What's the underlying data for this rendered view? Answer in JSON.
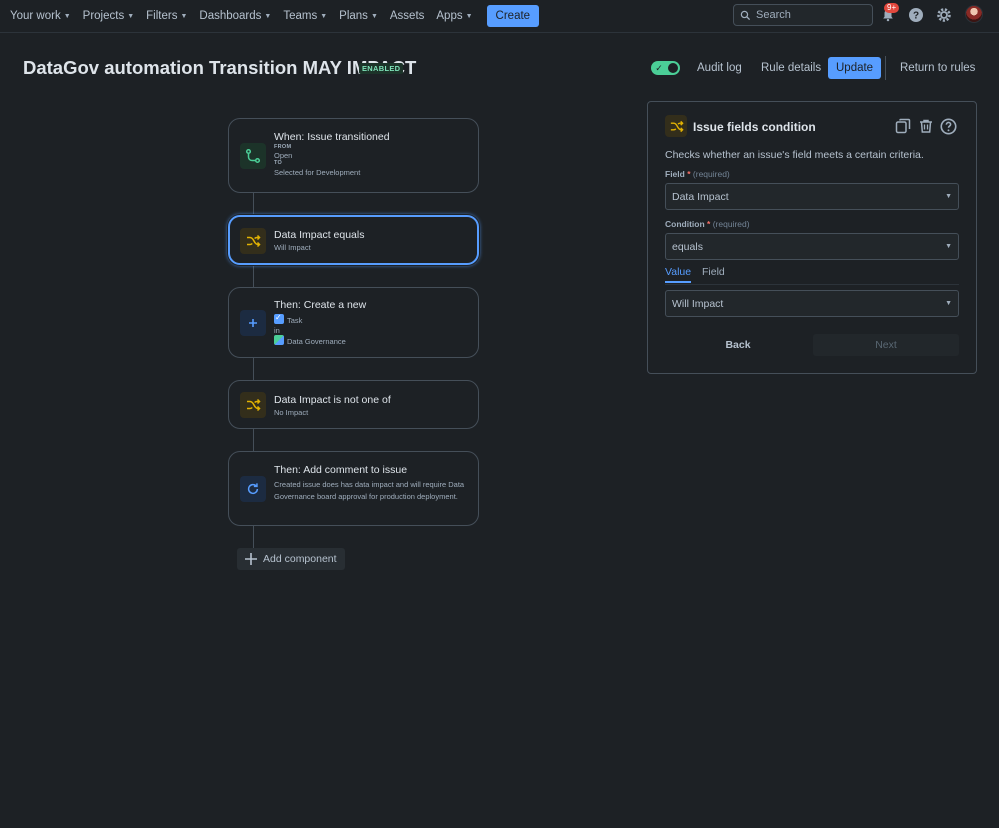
{
  "nav": {
    "items": [
      {
        "label": "Your work",
        "dropdown": true
      },
      {
        "label": "Projects",
        "dropdown": true
      },
      {
        "label": "Filters",
        "dropdown": true
      },
      {
        "label": "Dashboards",
        "dropdown": true
      },
      {
        "label": "Teams",
        "dropdown": true
      },
      {
        "label": "Plans",
        "dropdown": true
      },
      {
        "label": "Assets",
        "dropdown": false
      },
      {
        "label": "Apps",
        "dropdown": true
      }
    ],
    "create_label": "Create",
    "search_placeholder": "Search",
    "notifications_badge": "9+",
    "icons": [
      "bell-icon",
      "help-icon",
      "gear-icon",
      "avatar"
    ]
  },
  "header": {
    "title": "DataGov automation Transition MAY IMPACT",
    "status": "ENABLED",
    "toggle_on": true,
    "audit_log_label": "Audit log",
    "rule_details_label": "Rule details",
    "update_label": "Update",
    "return_label": "Return to rules"
  },
  "flow": {
    "trigger": {
      "title": "When: Issue transitioned",
      "from_label": "FROM",
      "from_value": "Open",
      "to_label": "TO",
      "to_value": "Selected for Development"
    },
    "condition1": {
      "title": "Data Impact equals",
      "sub": "Will Impact"
    },
    "action1": {
      "title": "Then: Create a new",
      "issue_type": "Task",
      "in_label": "in",
      "project": "Data Governance"
    },
    "condition2": {
      "title": "Data Impact is not one of",
      "sub": "No Impact"
    },
    "action2": {
      "title": "Then: Add comment to issue",
      "sub": "Created issue does has data impact and will require Data Governance board approval for production deployment."
    },
    "add_component_label": "Add component"
  },
  "panel": {
    "title": "Issue fields condition",
    "description": "Checks whether an issue's field meets a certain criteria.",
    "field_label": "Field",
    "field_required": "*",
    "field_hint": "(required)",
    "field_value": "Data Impact",
    "condition_label": "Condition",
    "condition_required": "*",
    "condition_hint": "(required)",
    "condition_value": "equals",
    "tabs": [
      "Value",
      "Field"
    ],
    "active_tab": "Value",
    "value_value": "Will Impact",
    "back_label": "Back",
    "next_label": "Next"
  },
  "colors": {
    "background": "#1d2125",
    "accent": "#579dff",
    "success": "#4bce97",
    "warning": "#e2b203",
    "border": "#454f59"
  }
}
